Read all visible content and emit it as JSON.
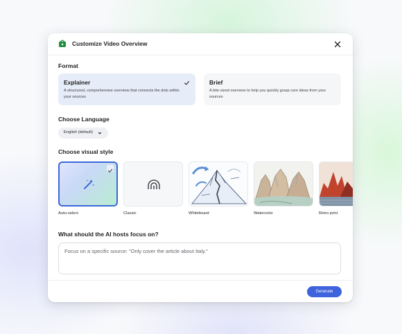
{
  "dialog": {
    "title": "Customize Video Overview",
    "icons": {
      "header": "video-overview-icon",
      "close": "close-icon"
    }
  },
  "format": {
    "label": "Format",
    "options": [
      {
        "name": "Explainer",
        "description": "A structured, comprehensive overview that connects the dots within your sources",
        "selected": true
      },
      {
        "name": "Brief",
        "description": "A bite-sized overview to help you quickly grasp core ideas from your sources",
        "selected": false
      }
    ]
  },
  "language": {
    "label": "Choose Language",
    "selected": "English (default)"
  },
  "visual_style": {
    "label": "Choose visual style",
    "options": [
      {
        "name": "Auto-select",
        "selected": true,
        "icon": "magic-wand-icon"
      },
      {
        "name": "Classic",
        "icon": "rainbow-arch-icon"
      },
      {
        "name": "Whiteboard"
      },
      {
        "name": "Watercolor"
      },
      {
        "name": "Retro print"
      }
    ]
  },
  "focus": {
    "label": "What should the AI hosts focus on?",
    "placeholder": "Focus on a specific source: \"Only cover the article about Italy.\""
  },
  "actions": {
    "generate": "Generate"
  },
  "colors": {
    "accent": "#3d63dd",
    "selected_card": "#e6ecf8",
    "brand_green": "#1e8e3e"
  }
}
